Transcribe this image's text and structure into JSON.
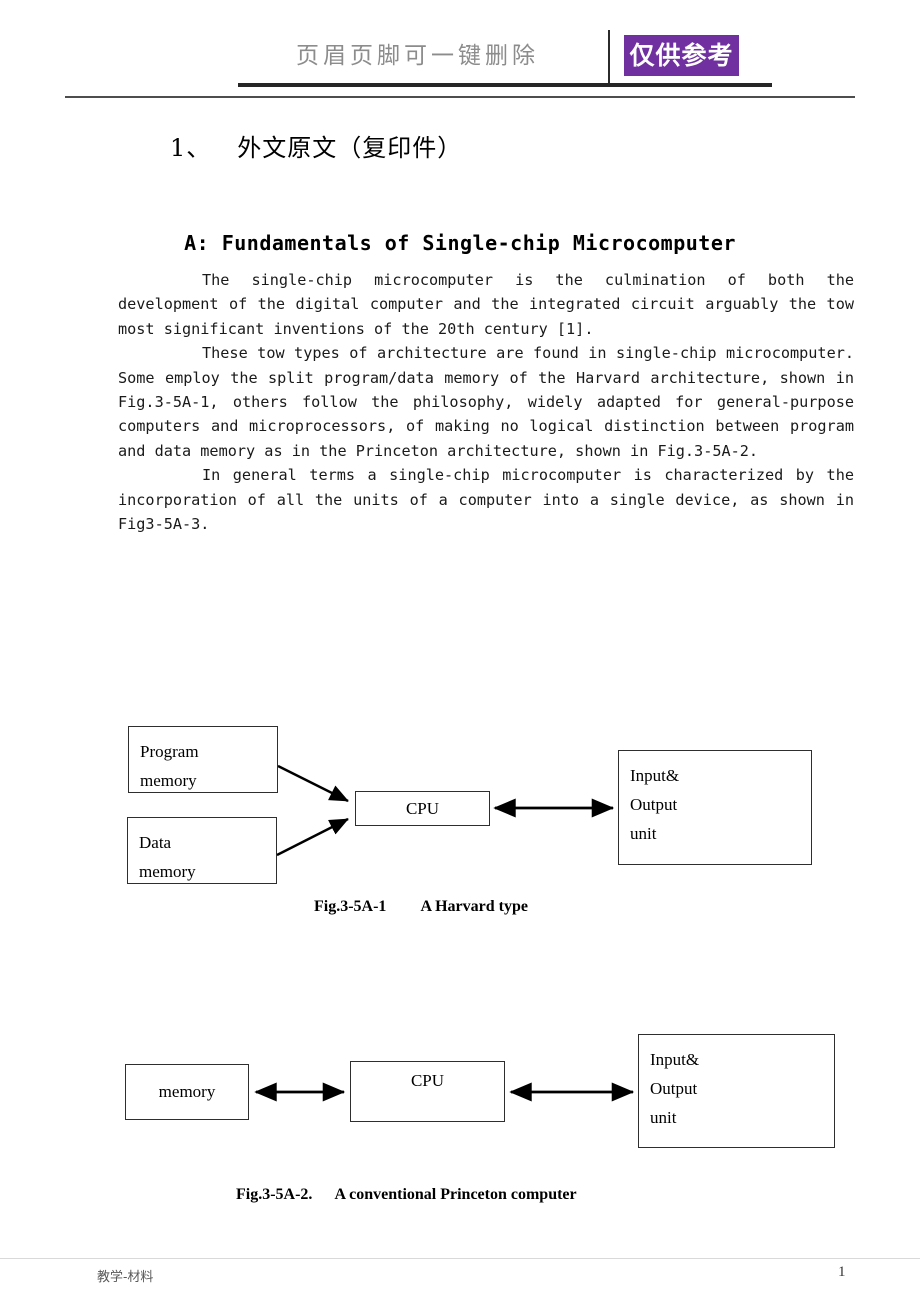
{
  "header": {
    "watermark_text": "页眉页脚可一键删除",
    "badge_text": "仅供参考",
    "badge_color": "#7030a0"
  },
  "document": {
    "section_number": "1、",
    "section_title": "外文原文（复印件）",
    "article_heading": "A: Fundamentals of Single-chip Microcomputer",
    "paragraphs": [
      "The single-chip microcomputer is the culmination of both the development of the digital computer and the integrated circuit arguably the tow most significant inventions of the 20th century [1].",
      "These tow types of architecture are found in single-chip microcomputer. Some employ the split program/data memory of the Harvard architecture, shown in Fig.3-5A-1, others follow the philosophy, widely adapted for general-purpose computers and microprocessors, of making no logical distinction between program and data memory as in the Princeton architecture, shown in Fig.3-5A-2.",
      "In general terms a single-chip microcomputer is characterized by the incorporation of all the units of a computer into a single device, as shown in Fig3-5A-3."
    ]
  },
  "figures": [
    {
      "id": "fig-3-5A-1",
      "caption_label": "Fig.3-5A-1",
      "caption_title": "A Harvard type",
      "boxes": {
        "program_memory": {
          "line1": "Program",
          "line2": "memory"
        },
        "data_memory": {
          "line1": "Data",
          "line2": "memory"
        },
        "cpu": {
          "label": "CPU"
        },
        "io_unit": {
          "line1": "Input&",
          "line2": "Output",
          "line3": "unit"
        }
      }
    },
    {
      "id": "fig-3-5A-2",
      "caption_label": "Fig.3-5A-2.",
      "caption_title": "A conventional Princeton computer",
      "boxes": {
        "memory": {
          "label": "memory"
        },
        "cpu": {
          "label": "CPU"
        },
        "io_unit": {
          "line1": "Input&",
          "line2": "Output",
          "line3": "unit"
        }
      }
    }
  ],
  "footer": {
    "left_text": "教学-材料",
    "page_number": "1"
  }
}
